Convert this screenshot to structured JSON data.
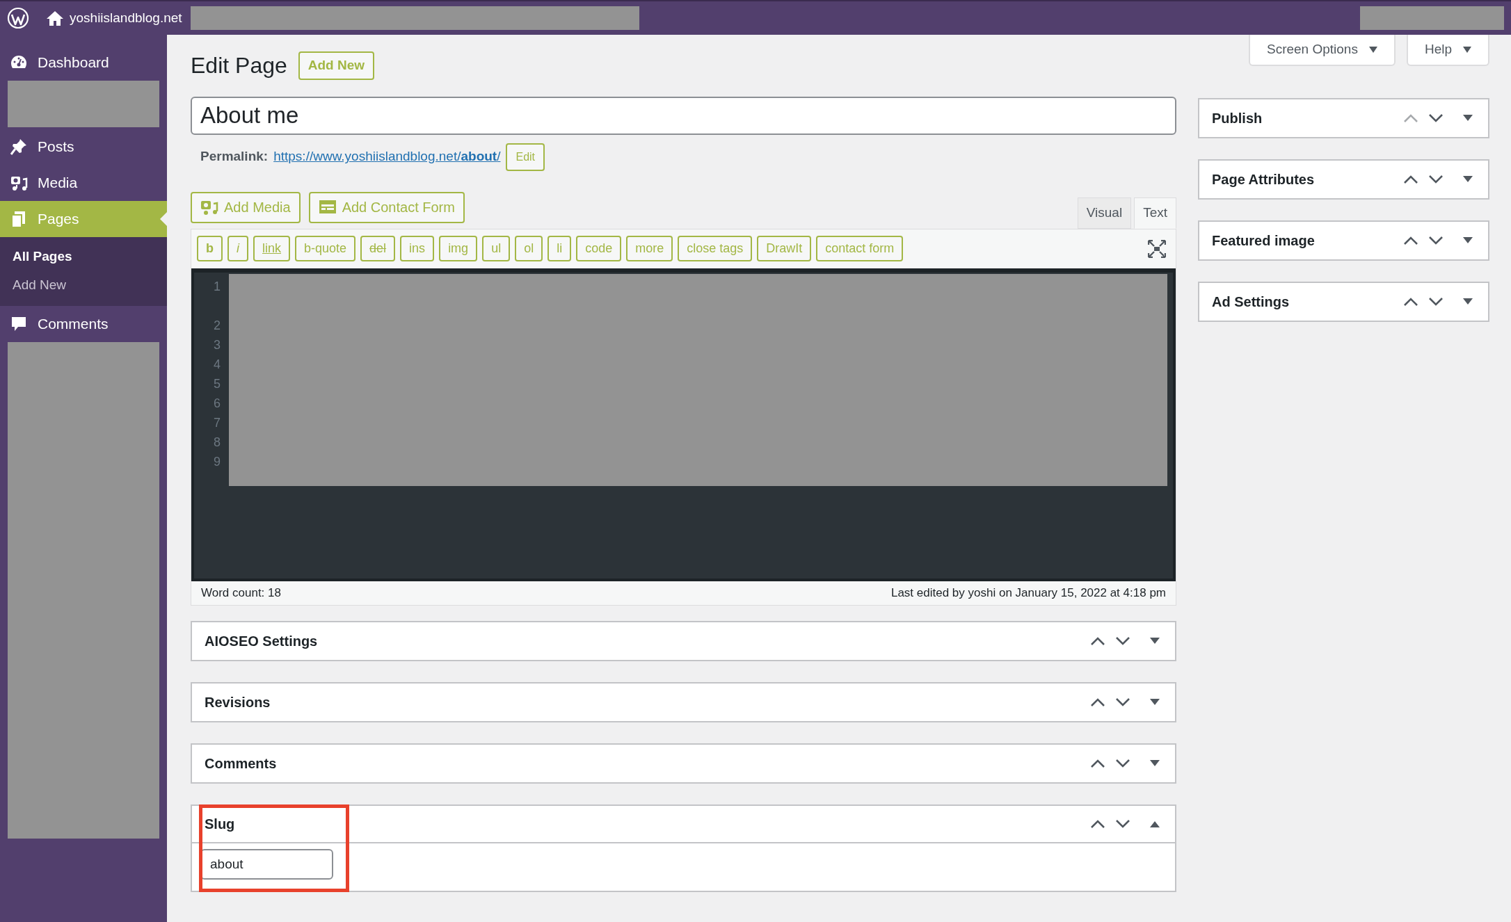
{
  "admin_bar": {
    "site_name": "yoshiislandblog.net"
  },
  "screen_meta": [
    {
      "label": "Screen Options"
    },
    {
      "label": "Help"
    }
  ],
  "sidebar": {
    "items": [
      {
        "kind": "menu",
        "label": "Dashboard",
        "current": false
      },
      {
        "kind": "redacted"
      },
      {
        "kind": "menu",
        "label": "Posts",
        "current": false
      },
      {
        "kind": "menu",
        "label": "Media",
        "current": false
      },
      {
        "kind": "menu",
        "label": "Pages",
        "current": true,
        "children": [
          {
            "label": "All Pages",
            "selected": true
          },
          {
            "label": "Add New",
            "selected": false
          }
        ]
      },
      {
        "kind": "menu",
        "label": "Comments",
        "current": false
      },
      {
        "kind": "redacted"
      }
    ]
  },
  "heading": {
    "title": "Edit Page",
    "add_new": "Add New"
  },
  "post_title": "About me",
  "permalink": {
    "label": "Permalink:",
    "url": "https://www.yoshiislandblog.net/**about**/",
    "edit": "Edit"
  },
  "media_buttons": [
    "Add Media",
    "Add Contact Form"
  ],
  "editor_tabs": [
    {
      "label": "Visual",
      "selected": false
    },
    {
      "label": "Text",
      "selected": true
    }
  ],
  "quicktags": [
    {
      "label": "b",
      "kind": "bold"
    },
    {
      "label": "i",
      "kind": "italic"
    },
    {
      "label": "link",
      "kind": "link"
    },
    {
      "label": "b-quote",
      "kind": "plain"
    },
    {
      "label": "del",
      "kind": "strike"
    },
    {
      "label": "ins",
      "kind": "plain"
    },
    {
      "label": "img",
      "kind": "plain"
    },
    {
      "label": "ul",
      "kind": "plain"
    },
    {
      "label": "ol",
      "kind": "plain"
    },
    {
      "label": "li",
      "kind": "plain"
    },
    {
      "label": "code",
      "kind": "plain"
    },
    {
      "label": "more",
      "kind": "plain"
    },
    {
      "label": "close tags",
      "kind": "plain"
    },
    {
      "label": "DrawIt",
      "kind": "plain"
    },
    {
      "label": "contact form",
      "kind": "plain"
    }
  ],
  "line_numbers": [
    {
      "number": "1",
      "wrapped": true
    },
    {
      "number": "2",
      "wrapped": false
    },
    {
      "number": "3",
      "wrapped": false
    },
    {
      "number": "4",
      "wrapped": false
    },
    {
      "number": "5",
      "wrapped": false
    },
    {
      "number": "6",
      "wrapped": false
    },
    {
      "number": "7",
      "wrapped": false
    },
    {
      "number": "8",
      "wrapped": false
    },
    {
      "number": "9",
      "wrapped": false
    }
  ],
  "status_bar": {
    "word_count": "Word count: 18",
    "last_edited": "Last edited by yoshi on January 15, 2022 at 4:18 pm"
  },
  "main_boxes": [
    {
      "title": "AIOSEO Settings",
      "expanded": false,
      "highlighted": false,
      "up_disabled": false
    },
    {
      "title": "Revisions",
      "expanded": false,
      "highlighted": false,
      "up_disabled": false
    },
    {
      "title": "Comments",
      "expanded": false,
      "highlighted": false,
      "up_disabled": false
    },
    {
      "title": "Slug",
      "expanded": true,
      "highlighted": true,
      "up_disabled": false,
      "field_value": "about"
    }
  ],
  "side_boxes": [
    {
      "title": "Publish",
      "expanded": false,
      "up_disabled": true
    },
    {
      "title": "Page Attributes",
      "expanded": false,
      "up_disabled": false
    },
    {
      "title": "Featured image",
      "expanded": false,
      "up_disabled": false
    },
    {
      "title": "Ad Settings",
      "expanded": false,
      "up_disabled": false
    }
  ]
}
